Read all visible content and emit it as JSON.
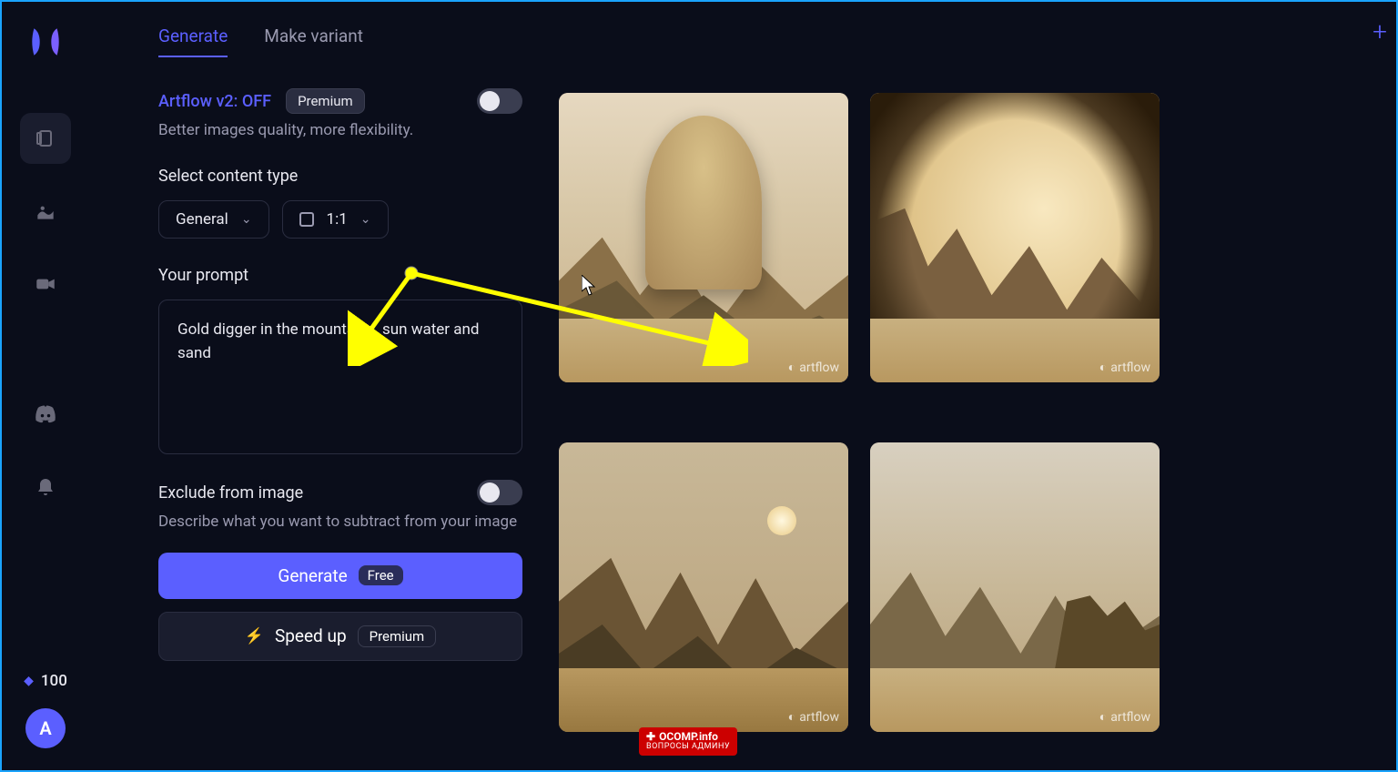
{
  "tabs": {
    "generate": "Generate",
    "variant": "Make variant"
  },
  "v2": {
    "label": "Artflow v2: OFF",
    "badge": "Premium",
    "sub": "Better images quality, more flexibility."
  },
  "content_type": {
    "label": "Select content type",
    "general": "General",
    "aspect": "1:1"
  },
  "prompt": {
    "label": "Your prompt",
    "value": "Gold digger in the mountains, sun water and sand"
  },
  "exclude": {
    "label": "Exclude from image",
    "sub": "Describe what you want to subtract from your image"
  },
  "generate_btn": {
    "label": "Generate",
    "badge": "Free"
  },
  "speedup": {
    "label": "Speed up",
    "badge": "Premium"
  },
  "credits": "100",
  "avatar_letter": "A",
  "watermark": "artflow",
  "attribution": {
    "line1": "OCOMP.info",
    "line2": "ВОПРОСЫ АДМИНУ"
  }
}
